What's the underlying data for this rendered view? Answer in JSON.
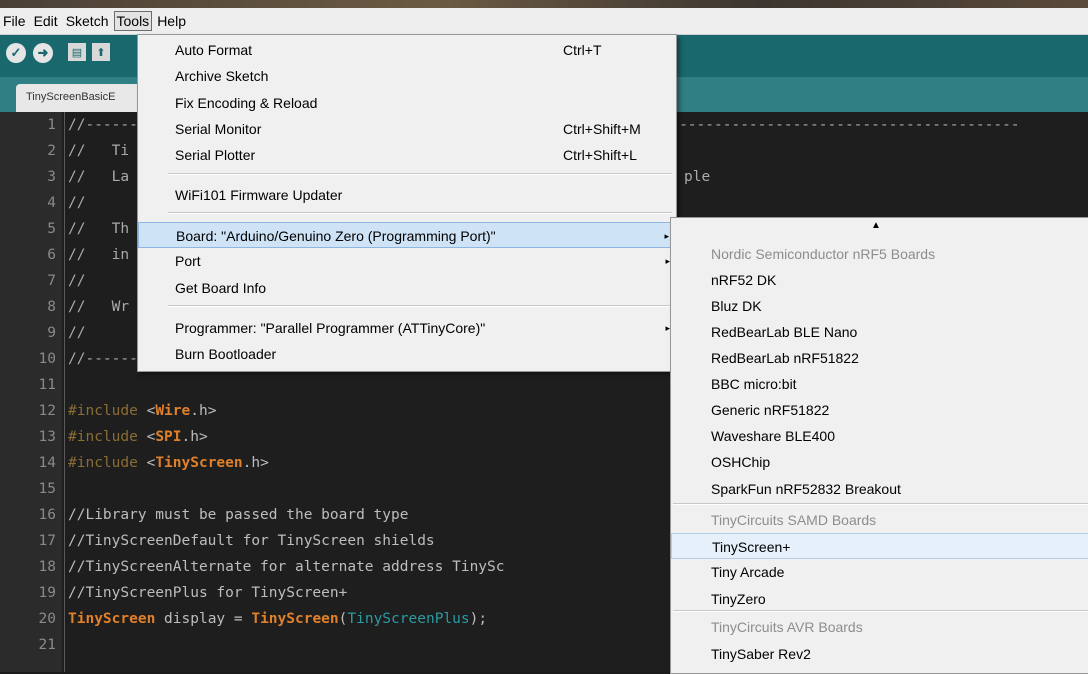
{
  "menubar": [
    "File",
    "Edit",
    "Sketch",
    "Tools",
    "Help"
  ],
  "tab": {
    "label": "TinyScreenBasicE"
  },
  "toolbar": {
    "verify": "✓",
    "upload": "➜",
    "new": "▤",
    "open": "⬆"
  },
  "code_lines": [
    {
      "n": "1",
      "parts": [
        {
          "c": "cm",
          "t": "//-----------------------------------------------------------------------------------------------------------"
        }
      ]
    },
    {
      "n": "2",
      "parts": [
        {
          "c": "cm",
          "t": "//   Ti"
        }
      ]
    },
    {
      "n": "3",
      "parts": [
        {
          "c": "cm",
          "t": "//   La"
        }
      ]
    },
    {
      "n": "4",
      "parts": [
        {
          "c": "cm",
          "t": "//"
        }
      ]
    },
    {
      "n": "5",
      "parts": [
        {
          "c": "cm",
          "t": "//   Th"
        }
      ]
    },
    {
      "n": "6",
      "parts": [
        {
          "c": "cm",
          "t": "//   in"
        }
      ]
    },
    {
      "n": "7",
      "parts": [
        {
          "c": "cm",
          "t": "//"
        }
      ]
    },
    {
      "n": "8",
      "parts": [
        {
          "c": "cm",
          "t": "//   Wr"
        }
      ]
    },
    {
      "n": "9",
      "parts": [
        {
          "c": "cm",
          "t": "//"
        }
      ]
    },
    {
      "n": "10",
      "parts": [
        {
          "c": "cm",
          "t": "//-----------------------------------------------------------------------------------------------------------"
        }
      ]
    },
    {
      "n": "11",
      "parts": []
    },
    {
      "n": "12",
      "parts": [
        {
          "c": "pp",
          "t": "#include "
        },
        {
          "c": "",
          "t": "<"
        },
        {
          "c": "hd",
          "t": "Wire"
        },
        {
          "c": "",
          "t": ".h>"
        }
      ]
    },
    {
      "n": "13",
      "parts": [
        {
          "c": "pp",
          "t": "#include "
        },
        {
          "c": "",
          "t": "<"
        },
        {
          "c": "hd",
          "t": "SPI"
        },
        {
          "c": "",
          "t": ".h>"
        }
      ]
    },
    {
      "n": "14",
      "parts": [
        {
          "c": "pp",
          "t": "#include "
        },
        {
          "c": "",
          "t": "<"
        },
        {
          "c": "hd",
          "t": "TinyScreen"
        },
        {
          "c": "",
          "t": ".h>"
        }
      ]
    },
    {
      "n": "15",
      "parts": []
    },
    {
      "n": "16",
      "parts": [
        {
          "c": "",
          "t": "//Library must be passed the board type"
        }
      ]
    },
    {
      "n": "17",
      "parts": [
        {
          "c": "",
          "t": "//TinyScreenDefault for TinyScreen shields"
        }
      ]
    },
    {
      "n": "18",
      "parts": [
        {
          "c": "",
          "t": "//TinyScreenAlternate for alternate address TinySc"
        }
      ]
    },
    {
      "n": "19",
      "parts": [
        {
          "c": "",
          "t": "//TinyScreenPlus for TinyScreen+"
        }
      ]
    },
    {
      "n": "20",
      "parts": [
        {
          "c": "kw",
          "t": "TinyScreen"
        },
        {
          "c": "",
          "t": " display = "
        },
        {
          "c": "kw",
          "t": "TinyScreen"
        },
        {
          "c": "",
          "t": "("
        },
        {
          "c": "cn",
          "t": "TinyScreenPlus"
        },
        {
          "c": "",
          "t": ");"
        }
      ]
    },
    {
      "n": "21",
      "parts": []
    }
  ],
  "code_tail_2": "ple",
  "tools_menu": {
    "items": [
      {
        "label": "Auto Format",
        "shortcut": "Ctrl+T"
      },
      {
        "label": "Archive Sketch",
        "shortcut": ""
      },
      {
        "label": "Fix Encoding & Reload",
        "shortcut": ""
      },
      {
        "label": "Serial Monitor",
        "shortcut": "Ctrl+Shift+M"
      },
      {
        "label": "Serial Plotter",
        "shortcut": "Ctrl+Shift+L"
      },
      {
        "label": "WiFi101 Firmware Updater",
        "shortcut": ""
      },
      {
        "label": "Board: \"Arduino/Genuino Zero (Programming Port)\"",
        "shortcut": ""
      },
      {
        "label": "Port",
        "shortcut": ""
      },
      {
        "label": "Get Board Info",
        "shortcut": ""
      },
      {
        "label": "Programmer: \"Parallel Programmer (ATTinyCore)\"",
        "shortcut": ""
      },
      {
        "label": "Burn Bootloader",
        "shortcut": ""
      }
    ],
    "submenu_arrow": "▸"
  },
  "board_submenu": {
    "scroll_up": "▲",
    "items": [
      {
        "label": "Nordic Semiconductor nRF5 Boards",
        "header": true
      },
      {
        "label": "nRF52 DK"
      },
      {
        "label": "Bluz DK"
      },
      {
        "label": "RedBearLab BLE Nano"
      },
      {
        "label": "RedBearLab nRF51822"
      },
      {
        "label": "BBC micro:bit"
      },
      {
        "label": "Generic nRF51822"
      },
      {
        "label": "Waveshare BLE400"
      },
      {
        "label": "OSHChip"
      },
      {
        "label": "SparkFun nRF52832 Breakout"
      },
      {
        "label": "TinyCircuits SAMD Boards",
        "header": true
      },
      {
        "label": "TinyScreen+",
        "selected": true
      },
      {
        "label": "Tiny Arcade"
      },
      {
        "label": "TinyZero"
      },
      {
        "label": "TinyCircuits AVR Boards",
        "header": true
      },
      {
        "label": "TinySaber Rev2"
      }
    ]
  }
}
